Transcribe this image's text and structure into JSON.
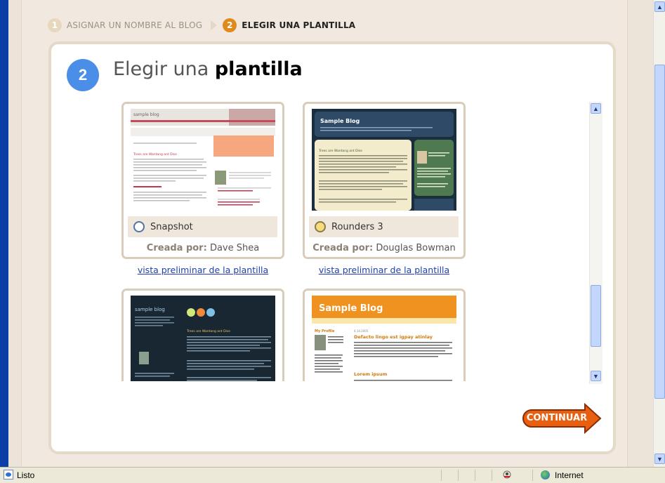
{
  "steps": [
    {
      "num": "1",
      "label": "ASIGNAR UN NOMBRE AL BLOG",
      "active": false
    },
    {
      "num": "2",
      "label": "ELEGIR UNA PLANTILLA",
      "active": true
    }
  ],
  "header": {
    "num": "2",
    "title_plain": "Elegir una ",
    "title_bold": "plantilla"
  },
  "templates": [
    {
      "name": "Snapshot",
      "author_prefix": "Creada por:",
      "author": "Dave Shea",
      "preview": "vista preliminar de la plantilla",
      "thumb_title": "sample blog"
    },
    {
      "name": "Rounders 3",
      "author_prefix": "Creada por:",
      "author": "Douglas Bowman",
      "preview": "vista preliminar de la plantilla",
      "thumb_title": "Sample Blog"
    },
    {
      "name": "",
      "thumb_title": "sample blog"
    },
    {
      "name": "",
      "thumb_title": "Sample Blog"
    }
  ],
  "thumbs": {
    "post_title": "Trees are Wantang ant Dise",
    "post_title_orange": "Defacto lingo est igpay atinlay",
    "lorem": "Lorem ipsum",
    "profile": "My Profile",
    "date": "4.14.2005"
  },
  "continue_label": "CONTINUAR",
  "statusbar": {
    "status": "Listo",
    "zone": "Internet"
  },
  "colors": {
    "accent_blue": "#4a8ee7",
    "accent_orange": "#e08a1e",
    "link": "#1f3fae"
  }
}
